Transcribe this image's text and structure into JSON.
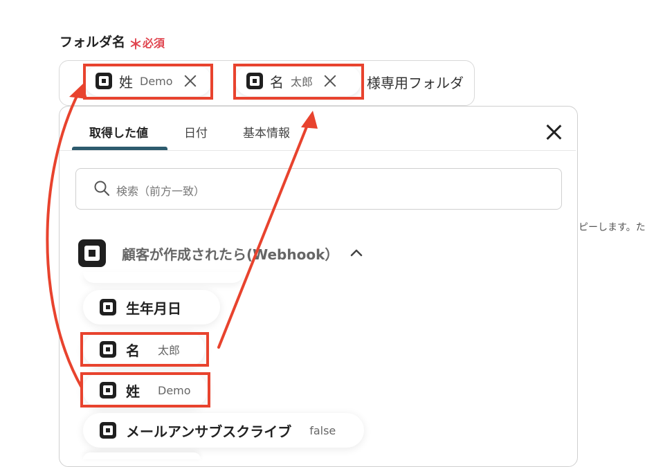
{
  "field": {
    "label": "フォルダ名",
    "required_mark": "＊",
    "required_text": "必須"
  },
  "input": {
    "chips": [
      {
        "label": "姓",
        "value": "Demo"
      },
      {
        "label": "名",
        "value": "太郎"
      }
    ],
    "suffix_text": "様専用フォルダ"
  },
  "dropdown": {
    "tabs": [
      {
        "label": "取得した値",
        "active": true
      },
      {
        "label": "日付",
        "active": false
      },
      {
        "label": "基本情報",
        "active": false
      }
    ],
    "search_placeholder": "検索（前方一致）",
    "section_title": "顧客が作成されたら(Webhook）",
    "items": [
      {
        "label": "生年月日",
        "value": ""
      },
      {
        "label": "名",
        "value": "太郎"
      },
      {
        "label": "姓",
        "value": "Demo"
      },
      {
        "label": "メールアンサブスクライブ",
        "value": "false"
      }
    ]
  },
  "side_text": "ピーします。た",
  "colors": {
    "highlight": "#e8432e",
    "required": "#e0454f",
    "tab_underline": "#2d5b6e"
  },
  "icons": [
    "square-app-icon",
    "close-icon",
    "search-icon",
    "chevron-up-icon"
  ]
}
